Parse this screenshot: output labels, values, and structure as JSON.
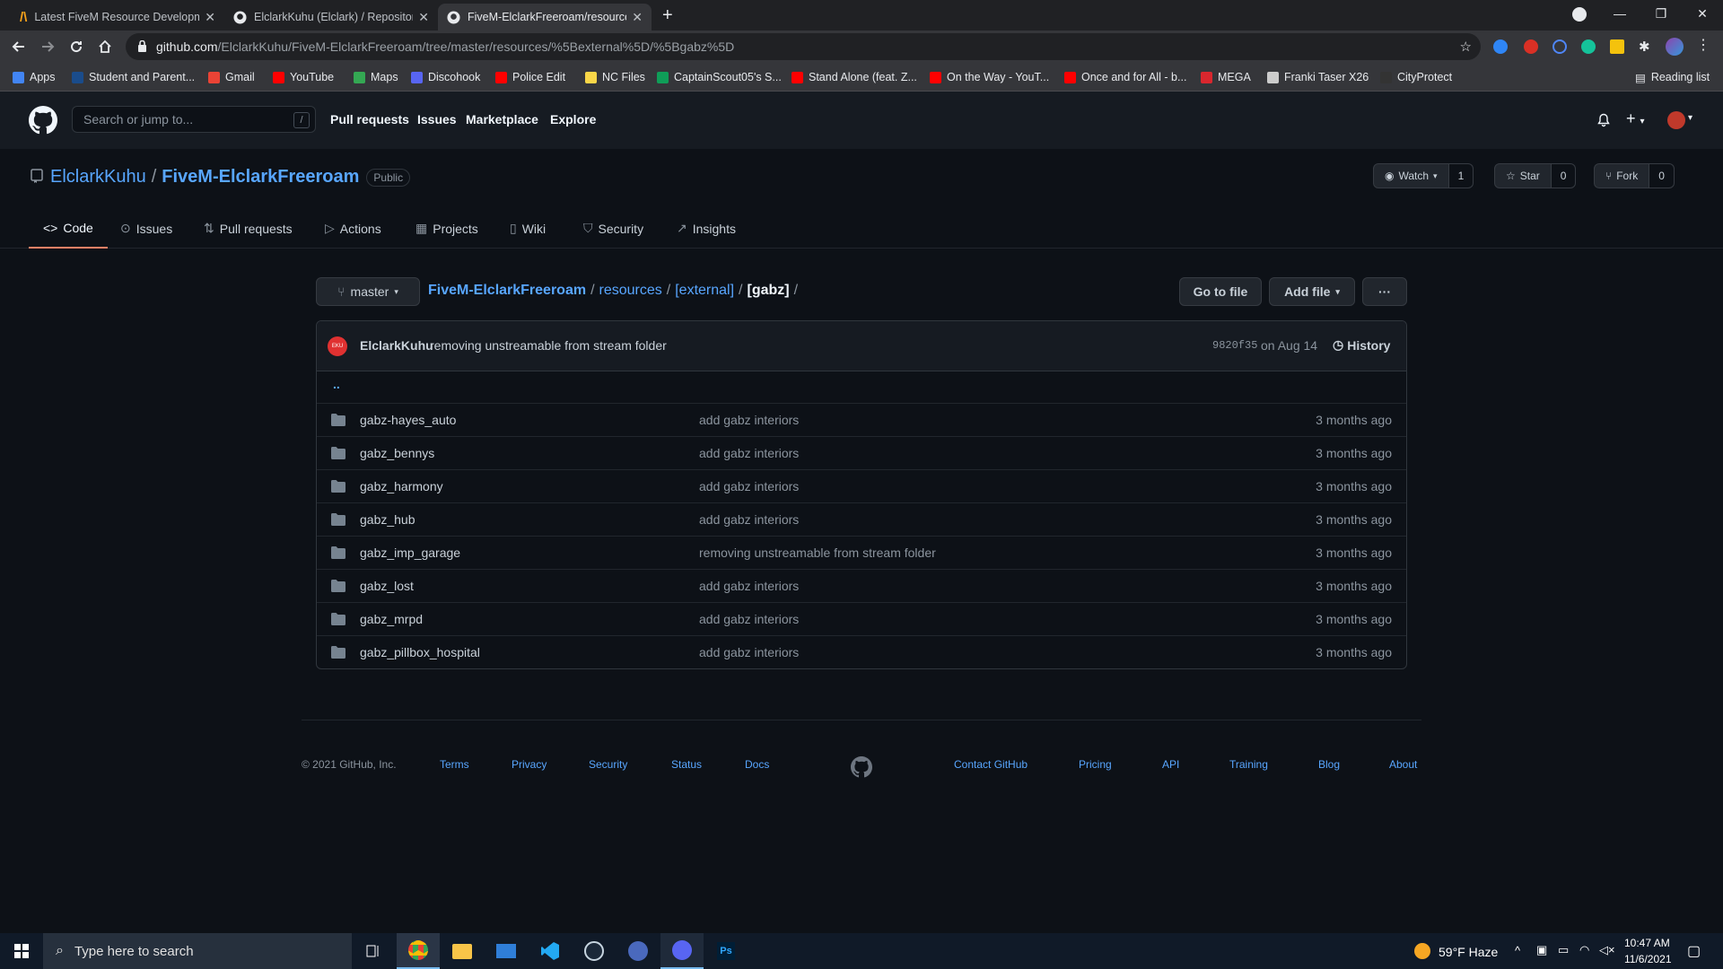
{
  "browser": {
    "tabs": [
      {
        "title": "Latest FiveM Resource Developm",
        "favicon": "caret-logo"
      },
      {
        "title": "ElclarkKuhu (Elclark) / Repositori",
        "favicon": "github-icon"
      },
      {
        "title": "FiveM-ElclarkFreeroam/resources",
        "favicon": "github-icon",
        "active": true
      }
    ],
    "url_host": "github.com",
    "url_path": "/ElclarkKuhu/FiveM-ElclarkFreeroam/tree/master/resources/%5Bexternal%5D/%5Bgabz%5D",
    "bookmarks": [
      {
        "label": "Apps",
        "color": "#4285f4"
      },
      {
        "label": "Student and Parent...",
        "color": "#1a4c8b"
      },
      {
        "label": "Gmail",
        "color": "#ea4335"
      },
      {
        "label": "YouTube",
        "color": "#ff0000"
      },
      {
        "label": "Maps",
        "color": "#34a853"
      },
      {
        "label": "Discohook",
        "color": "#5865f2"
      },
      {
        "label": "Police Edit",
        "color": "#ff0000"
      },
      {
        "label": "NC Files",
        "color": "#f9d648"
      },
      {
        "label": "CaptainScout05's S...",
        "color": "#0f9d58"
      },
      {
        "label": "Stand Alone (feat. Z...",
        "color": "#ff0000"
      },
      {
        "label": "On the Way - YouT...",
        "color": "#ff0000"
      },
      {
        "label": "Once and for All - b...",
        "color": "#ff0000"
      },
      {
        "label": "MEGA",
        "color": "#d9272e"
      },
      {
        "label": "Franki Taser X26",
        "color": "#cccccc"
      },
      {
        "label": "CityProtect",
        "color": "#333333"
      }
    ],
    "reading_list": "Reading list"
  },
  "github": {
    "search_placeholder": "Search or jump to...",
    "search_key": "/",
    "nav": [
      "Pull requests",
      "Issues",
      "Marketplace",
      "Explore"
    ]
  },
  "repo": {
    "owner": "ElclarkKuhu",
    "name": "FiveM-ElclarkFreeroam",
    "visibility": "Public",
    "watch_label": "Watch",
    "watch_count": "1",
    "star_label": "Star",
    "star_count": "0",
    "fork_label": "Fork",
    "fork_count": "0",
    "tabs": [
      "Code",
      "Issues",
      "Pull requests",
      "Actions",
      "Projects",
      "Wiki",
      "Security",
      "Insights"
    ]
  },
  "filenav": {
    "branch": "master",
    "crumbs": [
      "FiveM-ElclarkFreeroam",
      "resources",
      "[external]"
    ],
    "current": "[gabz]",
    "goto_file": "Go to file",
    "add_file": "Add file",
    "more": "···"
  },
  "commit": {
    "author": "ElclarkKuhu",
    "message": "removing unstreamable from stream folder",
    "sha": "9820f35",
    "date": "on Aug 14",
    "history": "History"
  },
  "files": {
    "parent": "..",
    "rows": [
      {
        "name": "gabz-hayes_auto",
        "message": "add gabz interiors",
        "age": "3 months ago"
      },
      {
        "name": "gabz_bennys",
        "message": "add gabz interiors",
        "age": "3 months ago"
      },
      {
        "name": "gabz_harmony",
        "message": "add gabz interiors",
        "age": "3 months ago"
      },
      {
        "name": "gabz_hub",
        "message": "add gabz interiors",
        "age": "3 months ago"
      },
      {
        "name": "gabz_imp_garage",
        "message": "removing unstreamable from stream folder",
        "age": "3 months ago"
      },
      {
        "name": "gabz_lost",
        "message": "add gabz interiors",
        "age": "3 months ago"
      },
      {
        "name": "gabz_mrpd",
        "message": "add gabz interiors",
        "age": "3 months ago"
      },
      {
        "name": "gabz_pillbox_hospital",
        "message": "add gabz interiors",
        "age": "3 months ago"
      }
    ]
  },
  "footer": {
    "copyright": "© 2021 GitHub, Inc.",
    "left_links": [
      "Terms",
      "Privacy",
      "Security",
      "Status",
      "Docs"
    ],
    "right_links": [
      "Contact GitHub",
      "Pricing",
      "API",
      "Training",
      "Blog",
      "About"
    ]
  },
  "taskbar": {
    "search_placeholder": "Type here to search",
    "weather": "59°F  Haze",
    "time": "10:47 AM",
    "date": "11/6/2021"
  }
}
